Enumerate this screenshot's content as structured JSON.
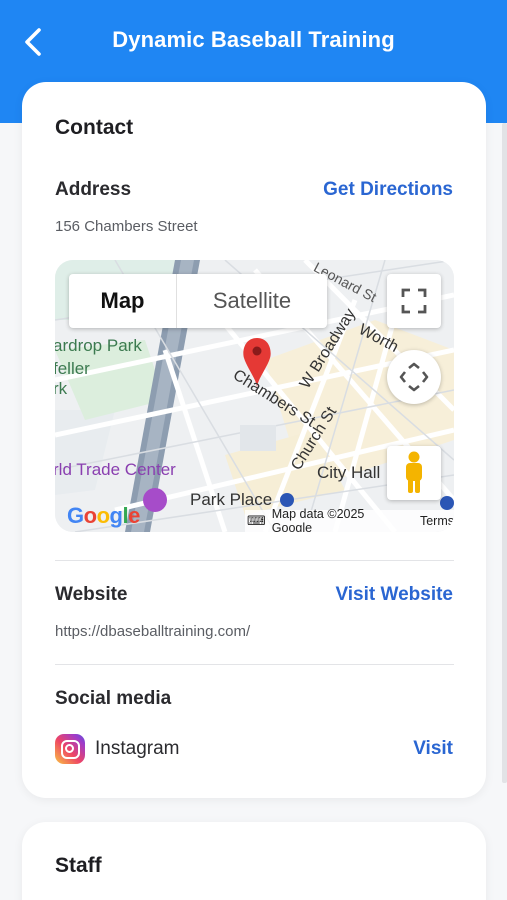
{
  "header": {
    "title": "Dynamic Baseball Training",
    "back_icon": "chevron-left-icon",
    "bg_color": "#1f86f3"
  },
  "contact": {
    "heading": "Contact",
    "address": {
      "label": "Address",
      "value": "156 Chambers Street",
      "action": "Get Directions"
    },
    "map": {
      "tabs": [
        "Map",
        "Satellite"
      ],
      "selected_tab": "Map",
      "labels": [
        "Leonard St",
        "W Broadway",
        "Worth",
        "ardrop Park",
        "feller",
        "rk",
        "Chambers St",
        "Church St",
        "City Hall",
        "rld Trade Center",
        "Park Place"
      ],
      "attribution": "Map data ©2025 Google",
      "terms": "Terms",
      "logo": "Google"
    },
    "website": {
      "label": "Website",
      "value": "https://dbaseballtraining.com/",
      "action": "Visit Website"
    },
    "social": {
      "label": "Social media",
      "items": [
        {
          "name": "Instagram",
          "action": "Visit",
          "icon": "instagram-icon"
        }
      ]
    }
  },
  "staff": {
    "heading": "Staff"
  },
  "accent_color": "#2a66d2"
}
